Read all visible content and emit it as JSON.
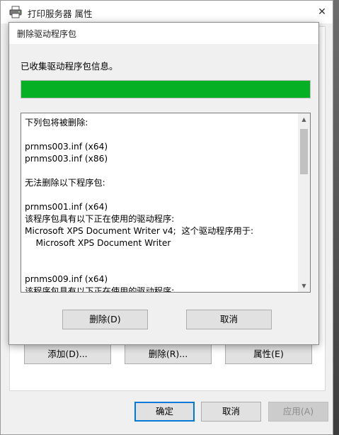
{
  "outer_window": {
    "title": "打印服务器 属性",
    "close_glyph": "✕",
    "panel_buttons": {
      "add": "添加(D)...",
      "delete": "删除(R)...",
      "properties": "属性(E)"
    },
    "footer_buttons": {
      "ok": "确定",
      "cancel": "取消",
      "apply": "应用(A)"
    }
  },
  "modal": {
    "title": "删除驱动程序包",
    "status": "已收集驱动程序包信息。",
    "progress": 100,
    "progress_color": "#06b025",
    "lines": [
      "下列包将被删除:",
      "",
      "prnms003.inf (x64)",
      "prnms003.inf (x86)",
      "",
      "无法删除以下程序包:",
      "",
      "prnms001.inf (x64)",
      "该程序包具有以下正在使用的驱动程序:",
      "Microsoft XPS Document Writer v4;  这个驱动程序用于:",
      "    Microsoft XPS Document Writer",
      "",
      "",
      "prnms009.inf (x64)",
      "该程序包具有以下正在使用的驱动程序:"
    ],
    "buttons": {
      "delete": "删除(D)",
      "cancel": "取消"
    }
  }
}
